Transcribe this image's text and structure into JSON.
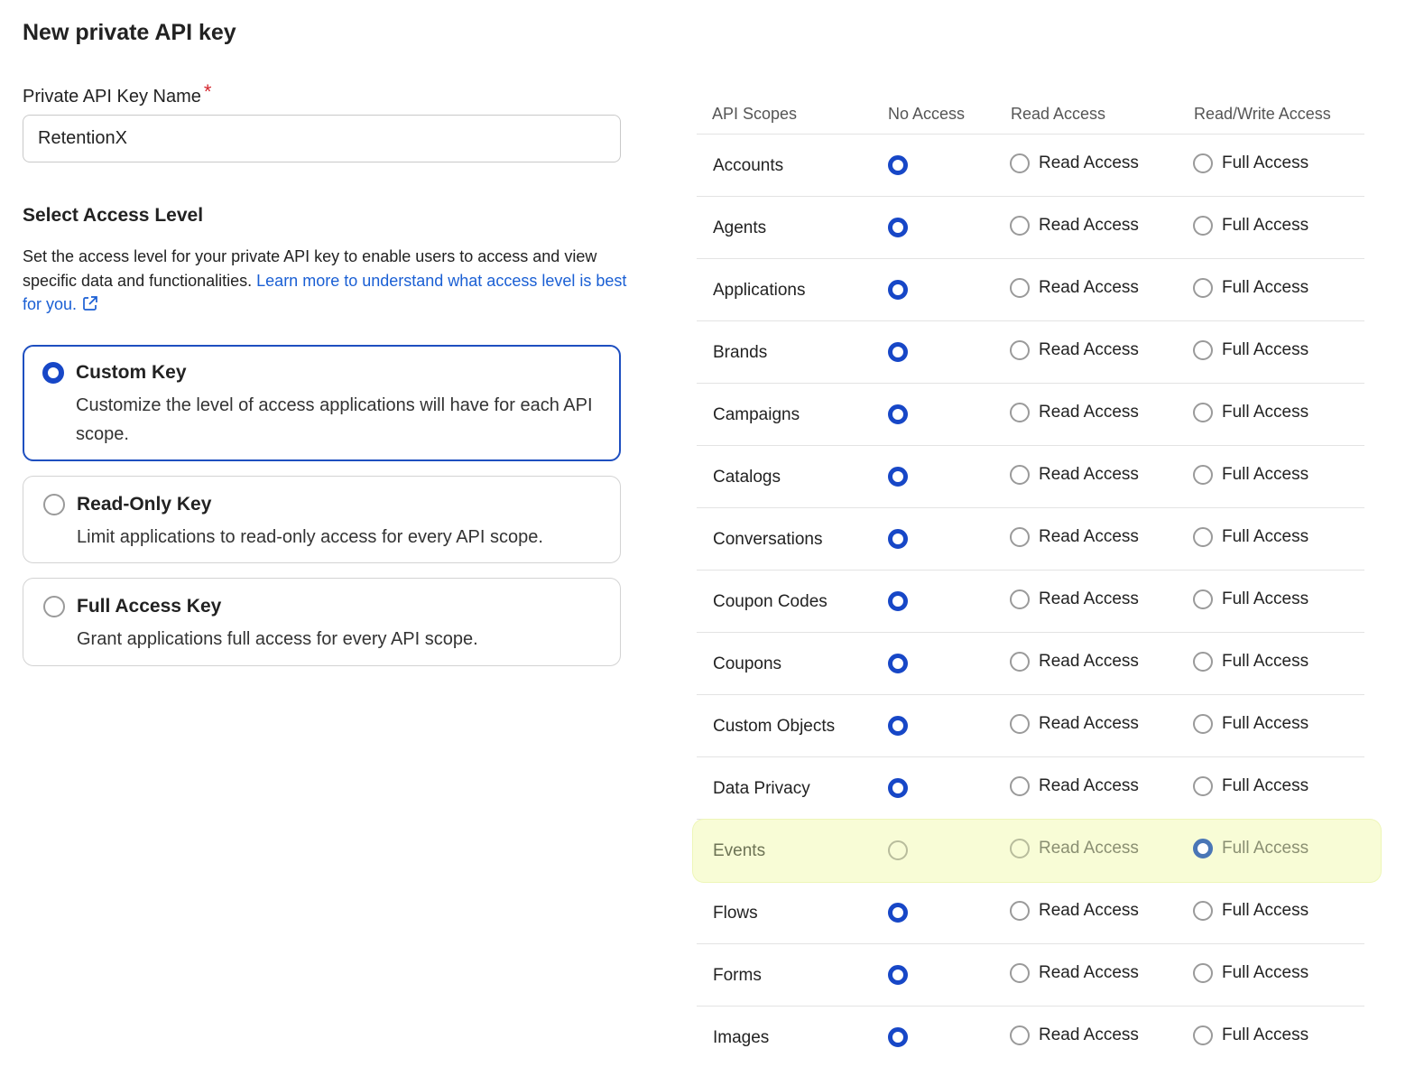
{
  "page_title": "New private API key",
  "name_field": {
    "label": "Private API Key Name",
    "required_mark": "*",
    "value": "RetentionX"
  },
  "access_section": {
    "title": "Select Access Level",
    "description": "Set the access level for your private API key to enable users to access and view specific data and functionalities. ",
    "link_text": "Learn more to understand what access level is best for you.",
    "link_icon": "external-link-icon"
  },
  "key_options": [
    {
      "title": "Custom Key",
      "description": "Customize the level of access applications will have for each API scope.",
      "selected": true
    },
    {
      "title": "Read-Only Key",
      "description": "Limit applications to read-only access for every API scope.",
      "selected": false
    },
    {
      "title": "Full Access Key",
      "description": "Grant applications full access for every API scope.",
      "selected": false
    }
  ],
  "scopes_table": {
    "headers": {
      "scope": "API Scopes",
      "no_access": "No Access",
      "read_access": "Read Access",
      "read_write": "Read/Write Access"
    },
    "read_label": "Read Access",
    "full_label": "Full Access",
    "rows": [
      {
        "name": "Accounts",
        "selected": "none"
      },
      {
        "name": "Agents",
        "selected": "none"
      },
      {
        "name": "Applications",
        "selected": "none"
      },
      {
        "name": "Brands",
        "selected": "none"
      },
      {
        "name": "Campaigns",
        "selected": "none"
      },
      {
        "name": "Catalogs",
        "selected": "none"
      },
      {
        "name": "Conversations",
        "selected": "none"
      },
      {
        "name": "Coupon Codes",
        "selected": "none"
      },
      {
        "name": "Coupons",
        "selected": "none"
      },
      {
        "name": "Custom Objects",
        "selected": "none"
      },
      {
        "name": "Data Privacy",
        "selected": "none"
      },
      {
        "name": "Events",
        "selected": "full",
        "highlighted": true
      },
      {
        "name": "Flows",
        "selected": "none"
      },
      {
        "name": "Forms",
        "selected": "none"
      },
      {
        "name": "Images",
        "selected": "none"
      }
    ]
  },
  "colors": {
    "accent": "#1747c7",
    "link": "#1a5fd4",
    "required": "#d4262e",
    "highlight_row": "#f8fcd6"
  }
}
